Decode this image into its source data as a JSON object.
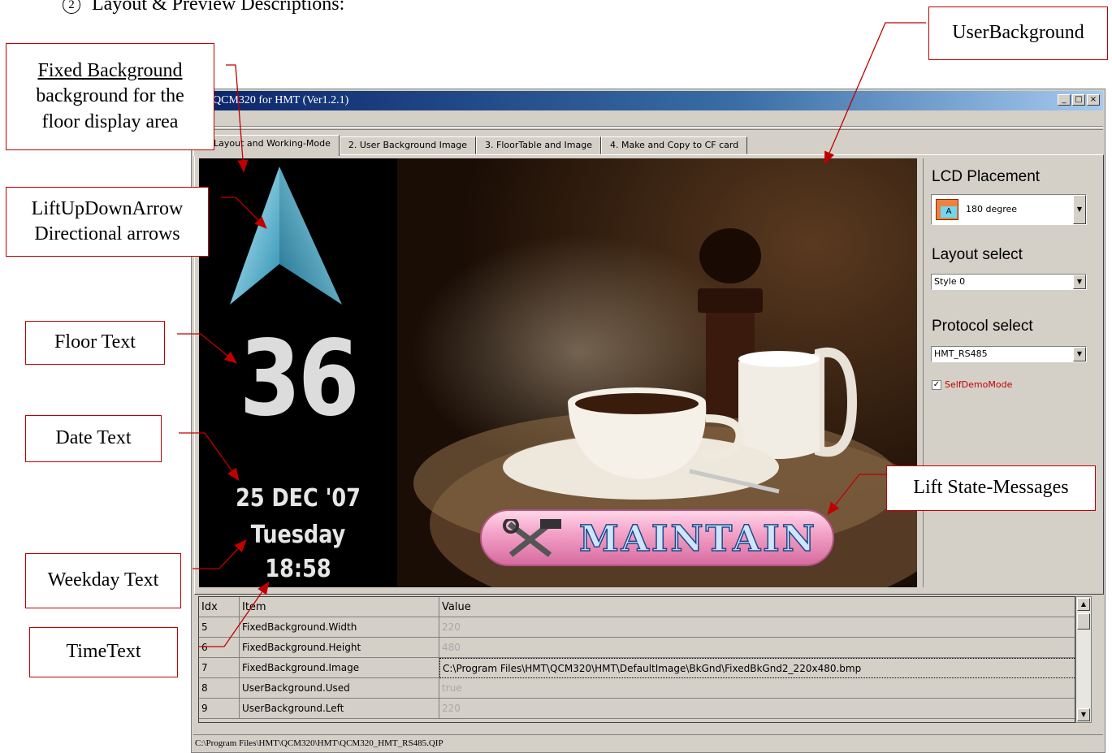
{
  "heading": {
    "number": "2",
    "text": "Layout & Preview Descriptions:"
  },
  "callouts": {
    "fixed_background_title": "Fixed Background",
    "fixed_background_desc1": "background for the",
    "fixed_background_desc2": "floor display area",
    "lift_arrow_title": "LiftUpDownArrow",
    "lift_arrow_desc": "Directional arrows",
    "floor_text": "Floor Text",
    "date_text": "Date Text",
    "weekday_text": "Weekday Text",
    "time_text": "TimeText",
    "user_background": "UserBackground",
    "lift_state": "Lift State-Messages"
  },
  "window": {
    "title": "QCM320 for HMT (Ver1.2.1)",
    "title_buttons": [
      "_",
      "□",
      "×"
    ],
    "tabs": [
      {
        "label": "1. Layout and Working-Mode",
        "active": true
      },
      {
        "label": "2. User Background Image",
        "active": false
      },
      {
        "label": "3. FloorTable and Image",
        "active": false
      },
      {
        "label": "4. Make and Copy to CF card",
        "active": false
      }
    ],
    "status_path": "C:\\Program Files\\HMT\\QCM320\\HMT\\QCM320_HMT_RS485.QIP"
  },
  "preview": {
    "floor": "36",
    "date": "25 DEC '07",
    "weekday": "Tuesday",
    "time": "18:58",
    "state_message": "MAINTAIN"
  },
  "side_panel": {
    "lcd_heading": "LCD Placement",
    "lcd_icon_letter": "A",
    "lcd_value": "180 degree",
    "layout_heading": "Layout select",
    "layout_value": "Style 0",
    "protocol_heading": "Protocol select",
    "protocol_value": "HMT_RS485",
    "self_demo_label": "SelfDemoMode",
    "self_demo_checked": true
  },
  "grid": {
    "headers": [
      "Idx",
      "Item",
      "Value"
    ],
    "rows": [
      {
        "idx": "5",
        "item": "FixedBackground.Width",
        "value": "220"
      },
      {
        "idx": "6",
        "item": "FixedBackground.Height",
        "value": "480"
      },
      {
        "idx": "7",
        "item": "FixedBackground.Image",
        "value": "C:\\Program Files\\HMT\\QCM320\\HMT\\DefaultImage\\BkGnd\\FixedBkGnd2_220x480.bmp"
      },
      {
        "idx": "8",
        "item": "UserBackground.Used",
        "value": "true"
      },
      {
        "idx": "9",
        "item": "UserBackground.Left",
        "value": "220"
      }
    ]
  },
  "colors": {
    "callout_border": "#c00000",
    "title_bar": "#0a246a",
    "self_demo": "#c00000"
  }
}
